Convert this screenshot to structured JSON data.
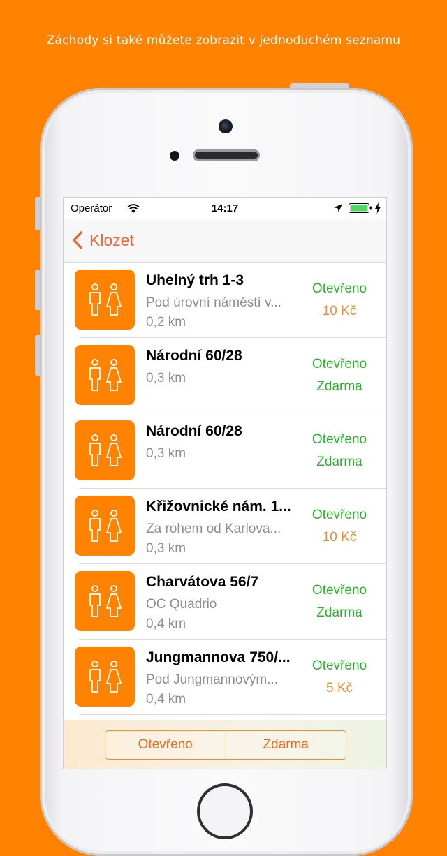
{
  "promo_text": "Záchody si také můžete zobrazit v jednoduchém seznamu",
  "status_bar": {
    "carrier": "Operátor",
    "time": "14:17"
  },
  "nav": {
    "back_label": "Klozet"
  },
  "colors": {
    "background": "#FF8200",
    "accent": "#F26434",
    "open": "#27B427",
    "paid": "#F28C28",
    "free": "#27B427"
  },
  "list": [
    {
      "title": "Uhelný trh 1-3",
      "subtitle": "Pod úrovní náměstí v...",
      "distance": "0,2 km",
      "status": "Otevřeno",
      "price": "10 Kč",
      "price_color": "#F28C28",
      "icon": "restroom-icon"
    },
    {
      "title": "Národní 60/28",
      "subtitle": "",
      "distance": "0,3 km",
      "status": "Otevřeno",
      "price": "Zdarma",
      "price_color": "#27B427",
      "icon": "restroom-icon"
    },
    {
      "title": "Národní 60/28",
      "subtitle": "",
      "distance": "0,3 km",
      "status": "Otevřeno",
      "price": "Zdarma",
      "price_color": "#27B427",
      "icon": "restroom-icon"
    },
    {
      "title": "Křižovnické nám. 1...",
      "subtitle": "Za rohem od Karlova...",
      "distance": "0,3 km",
      "status": "Otevřeno",
      "price": "10 Kč",
      "price_color": "#F28C28",
      "icon": "restroom-icon"
    },
    {
      "title": "Charvátova 56/7",
      "subtitle": "OC Quadrio",
      "distance": "0,4 km",
      "status": "Otevřeno",
      "price": "Zdarma",
      "price_color": "#27B427",
      "icon": "restroom-icon"
    },
    {
      "title": "Jungmannova 750/...",
      "subtitle": "Pod Jungmannovým...",
      "distance": "0,4 km",
      "status": "Otevřeno",
      "price": "5 Kč",
      "price_color": "#F28C28",
      "icon": "restroom-icon"
    }
  ],
  "filters": {
    "open_label": "Otevřeno",
    "free_label": "Zdarma"
  }
}
